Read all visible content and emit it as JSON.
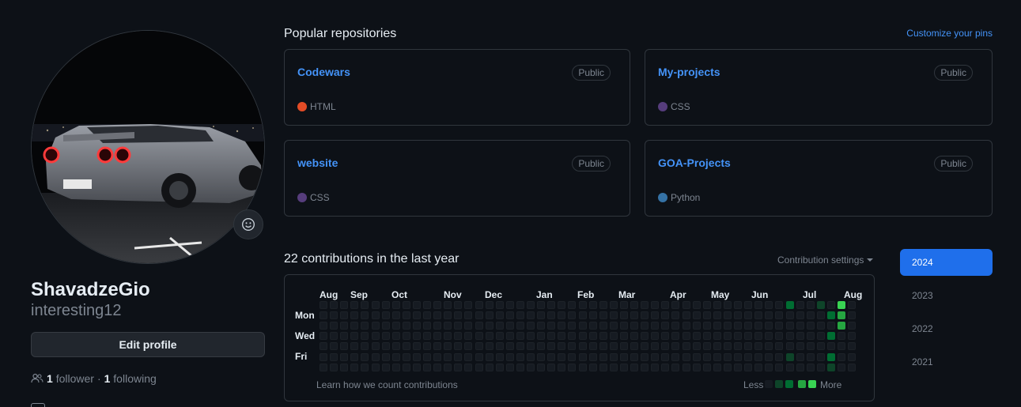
{
  "profile": {
    "display_name": "ShavadzeGio",
    "username": "interesting12",
    "edit_button": "Edit profile",
    "followers_count": "1",
    "followers_label": "follower",
    "following_count": "1",
    "following_label": "following",
    "separator": "·"
  },
  "pinned": {
    "title": "Popular repositories",
    "customize_label": "Customize your pins",
    "repos": [
      {
        "name": "Codewars",
        "visibility": "Public",
        "language": "HTML",
        "language_color": "#e34c26"
      },
      {
        "name": "My-projects",
        "visibility": "Public",
        "language": "CSS",
        "language_color": "#563d7c"
      },
      {
        "name": "website",
        "visibility": "Public",
        "language": "CSS",
        "language_color": "#563d7c"
      },
      {
        "name": "GOA-Projects",
        "visibility": "Public",
        "language": "Python",
        "language_color": "#3572A5"
      }
    ]
  },
  "contributions": {
    "title": "22 contributions in the last year",
    "settings_label": "Contribution settings",
    "months": [
      "Aug",
      "Sep",
      "Oct",
      "Nov",
      "Dec",
      "Jan",
      "Feb",
      "Mar",
      "Apr",
      "May",
      "Jun",
      "Jul",
      "Aug"
    ],
    "days": [
      "Mon",
      "Wed",
      "Fri"
    ],
    "learn_label": "Learn how we count contributions",
    "legend_less": "Less",
    "legend_more": "More",
    "colors": [
      "#161b22",
      "#0e4429",
      "#006d32",
      "#26a641",
      "#39d353"
    ],
    "active_cells": [
      {
        "week": 45,
        "day": 0,
        "level": 2
      },
      {
        "week": 45,
        "day": 5,
        "level": 1
      },
      {
        "week": 48,
        "day": 0,
        "level": 1
      },
      {
        "week": 49,
        "day": 1,
        "level": 2
      },
      {
        "week": 49,
        "day": 3,
        "level": 2
      },
      {
        "week": 49,
        "day": 5,
        "level": 2
      },
      {
        "week": 49,
        "day": 6,
        "level": 1
      },
      {
        "week": 50,
        "day": 0,
        "level": 4
      },
      {
        "week": 50,
        "day": 1,
        "level": 3
      },
      {
        "week": 50,
        "day": 2,
        "level": 3
      }
    ]
  },
  "years": [
    "2024",
    "2023",
    "2022",
    "2021"
  ],
  "accent_colors": {
    "link": "#4493f8",
    "active_year": "#1f6feb"
  }
}
